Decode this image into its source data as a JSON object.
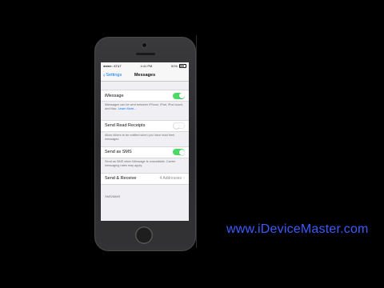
{
  "status_bar": {
    "carrier": "●●●●○ AT&T",
    "wifi_icon": "wifi-icon",
    "time": "4:41 PM",
    "battery_percent": "51%"
  },
  "nav": {
    "back_label": "Settings",
    "title": "Messages"
  },
  "rows": {
    "imessage": {
      "label": "iMessage",
      "on": true
    },
    "imessage_footer": "iMessages can be sent between iPhone, iPad, iPod touch, and Mac.",
    "imessage_footer_link": "Learn More...",
    "read_receipts": {
      "label": "Send Read Receipts",
      "on": false
    },
    "read_receipts_footer": "Allow others to be notified when you have read their messages.",
    "send_as_sms": {
      "label": "Send as SMS",
      "on": true
    },
    "send_as_sms_footer": "Send as SMS when iMessage is unavailable. Carrier messaging rates may apply.",
    "send_receive": {
      "label": "Send & Receive",
      "value": "4 Addresses"
    }
  },
  "section_header": "SMS/MMS",
  "website": "www.iDeviceMaster.com",
  "colors": {
    "accent": "#007aff",
    "toggle_on": "#4cd964",
    "website": "#3b5bff"
  }
}
